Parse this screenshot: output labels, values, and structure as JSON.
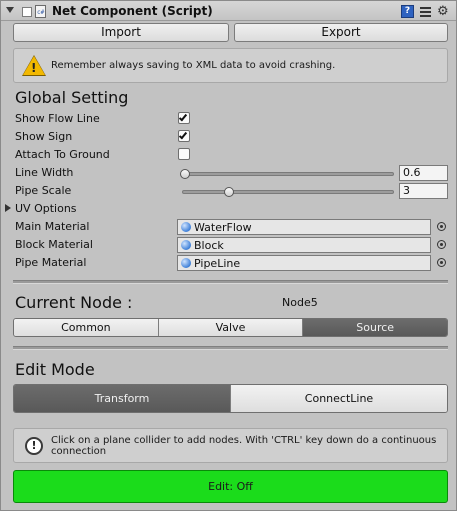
{
  "header": {
    "title": "Net Component (Script)",
    "script_icon_text": "c#",
    "help_icon_text": "?",
    "gear_glyph": "⚙"
  },
  "toolbar": {
    "import_label": "Import",
    "export_label": "Export"
  },
  "warning": {
    "text": "Remember always saving to XML data to avoid crashing.",
    "icon": "warning-icon",
    "mark": "!"
  },
  "global_setting": {
    "heading": "Global Setting",
    "show_flow_line": {
      "label": "Show Flow Line",
      "checked": true
    },
    "show_sign": {
      "label": "Show Sign",
      "checked": true
    },
    "attach_to_ground": {
      "label": "Attach To Ground",
      "checked": false
    },
    "line_width": {
      "label": "Line Width",
      "value": "0.6",
      "slider_fraction": 0.0
    },
    "pipe_scale": {
      "label": "Pipe Scale",
      "value": "3",
      "slider_fraction": 0.22
    },
    "uv_options": {
      "label": "UV Options"
    },
    "main_material": {
      "label": "Main Material",
      "value": "WaterFlow"
    },
    "block_material": {
      "label": "Block Material",
      "value": "Block"
    },
    "pipe_material": {
      "label": "Pipe Material",
      "value": "PipeLine"
    }
  },
  "current_node": {
    "heading": "Current Node :",
    "value": "Node5",
    "tabs": [
      "Common",
      "Valve",
      "Source"
    ],
    "selected": "Source"
  },
  "edit_mode": {
    "heading": "Edit Mode",
    "tabs": [
      "Transform",
      "ConnectLine"
    ],
    "selected": "Transform"
  },
  "info": {
    "text": "Click on a plane collider to add nodes. With 'CTRL' key down do a continuous connection",
    "mark": "!"
  },
  "edit_button": {
    "label": "Edit: Off",
    "color": "#1bdc1b"
  },
  "colors": {
    "background": "#c2c2c2",
    "selected_tab": "#636363",
    "edit_on_green": "#1bdc1b"
  }
}
